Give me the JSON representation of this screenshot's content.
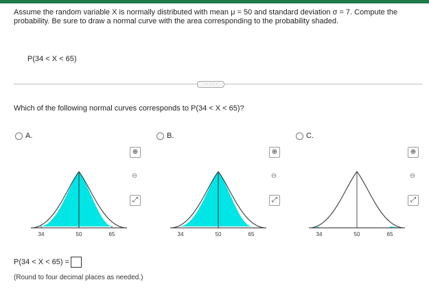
{
  "problem": {
    "intro": "Assume the random variable X is normally distributed with mean μ = 50 and standard deviation σ = 7. Compute the probability. Be sure to draw a normal curve with the area corresponding to the probability shaded.",
    "expression": "P(34 < X < 65)"
  },
  "divider_label": "· · · · ·",
  "question": "Which of the following normal curves corresponds to P(34 < X < 65)?",
  "options": [
    {
      "label": "A.",
      "ticks": [
        "34",
        "50",
        "65"
      ]
    },
    {
      "label": "B.",
      "ticks": [
        "34",
        "50",
        "65"
      ]
    },
    {
      "label": "C.",
      "ticks": [
        "34",
        "50",
        "65"
      ]
    }
  ],
  "tools": {
    "zoom_in": "⊕",
    "zoom_out": "⊖",
    "popout": "⤢"
  },
  "answer": {
    "prefix": "P(34 < X < 65) ="
  },
  "hint": "(Round to four decimal places as needed.)",
  "colors": {
    "shade": "#00e5e5",
    "bar": "#1f7a4a"
  }
}
